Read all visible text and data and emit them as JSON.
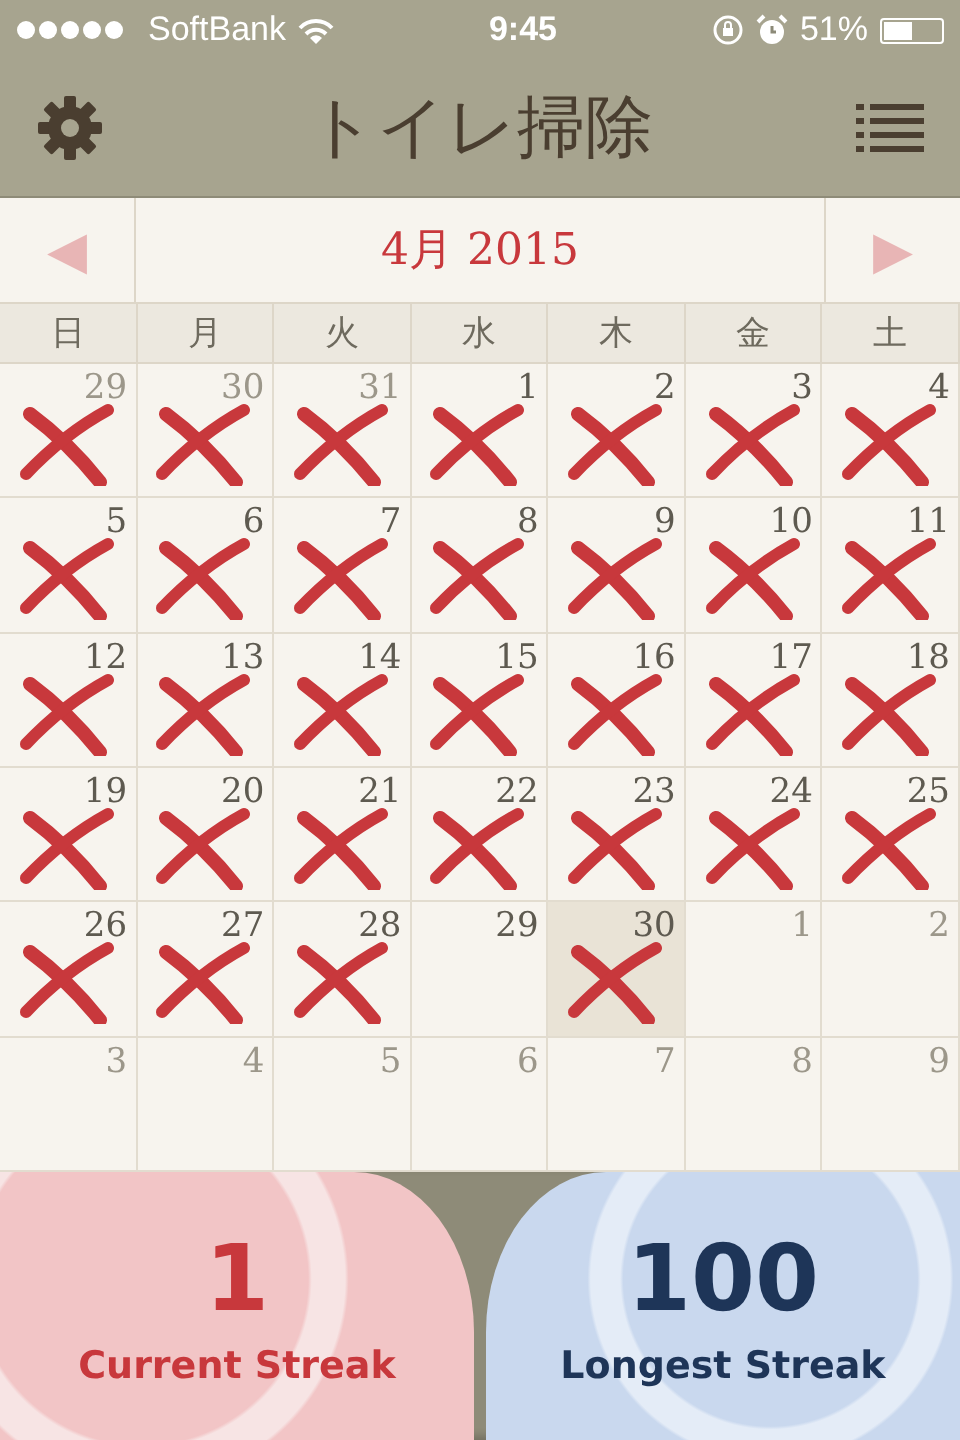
{
  "status_bar": {
    "carrier": "SoftBank",
    "time": "9:45",
    "battery": "51%"
  },
  "header": {
    "title": "トイレ掃除"
  },
  "month_nav": {
    "prev": "◀",
    "title": "4月 2015",
    "next": "▶"
  },
  "weekdays": [
    "日",
    "月",
    "火",
    "水",
    "木",
    "金",
    "土"
  ],
  "weeks": [
    [
      {
        "day": "29",
        "in_month": false,
        "marked": true,
        "selected": false
      },
      {
        "day": "30",
        "in_month": false,
        "marked": true,
        "selected": false
      },
      {
        "day": "31",
        "in_month": false,
        "marked": true,
        "selected": false
      },
      {
        "day": "1",
        "in_month": true,
        "marked": true,
        "selected": false
      },
      {
        "day": "2",
        "in_month": true,
        "marked": true,
        "selected": false
      },
      {
        "day": "3",
        "in_month": true,
        "marked": true,
        "selected": false
      },
      {
        "day": "4",
        "in_month": true,
        "marked": true,
        "selected": false
      }
    ],
    [
      {
        "day": "5",
        "in_month": true,
        "marked": true,
        "selected": false
      },
      {
        "day": "6",
        "in_month": true,
        "marked": true,
        "selected": false
      },
      {
        "day": "7",
        "in_month": true,
        "marked": true,
        "selected": false
      },
      {
        "day": "8",
        "in_month": true,
        "marked": true,
        "selected": false
      },
      {
        "day": "9",
        "in_month": true,
        "marked": true,
        "selected": false
      },
      {
        "day": "10",
        "in_month": true,
        "marked": true,
        "selected": false
      },
      {
        "day": "11",
        "in_month": true,
        "marked": true,
        "selected": false
      }
    ],
    [
      {
        "day": "12",
        "in_month": true,
        "marked": true,
        "selected": false
      },
      {
        "day": "13",
        "in_month": true,
        "marked": true,
        "selected": false
      },
      {
        "day": "14",
        "in_month": true,
        "marked": true,
        "selected": false
      },
      {
        "day": "15",
        "in_month": true,
        "marked": true,
        "selected": false
      },
      {
        "day": "16",
        "in_month": true,
        "marked": true,
        "selected": false
      },
      {
        "day": "17",
        "in_month": true,
        "marked": true,
        "selected": false
      },
      {
        "day": "18",
        "in_month": true,
        "marked": true,
        "selected": false
      }
    ],
    [
      {
        "day": "19",
        "in_month": true,
        "marked": true,
        "selected": false
      },
      {
        "day": "20",
        "in_month": true,
        "marked": true,
        "selected": false
      },
      {
        "day": "21",
        "in_month": true,
        "marked": true,
        "selected": false
      },
      {
        "day": "22",
        "in_month": true,
        "marked": true,
        "selected": false
      },
      {
        "day": "23",
        "in_month": true,
        "marked": true,
        "selected": false
      },
      {
        "day": "24",
        "in_month": true,
        "marked": true,
        "selected": false
      },
      {
        "day": "25",
        "in_month": true,
        "marked": true,
        "selected": false
      }
    ],
    [
      {
        "day": "26",
        "in_month": true,
        "marked": true,
        "selected": false
      },
      {
        "day": "27",
        "in_month": true,
        "marked": true,
        "selected": false
      },
      {
        "day": "28",
        "in_month": true,
        "marked": true,
        "selected": false
      },
      {
        "day": "29",
        "in_month": true,
        "marked": false,
        "selected": false
      },
      {
        "day": "30",
        "in_month": true,
        "marked": true,
        "selected": true
      },
      {
        "day": "1",
        "in_month": false,
        "marked": false,
        "selected": false
      },
      {
        "day": "2",
        "in_month": false,
        "marked": false,
        "selected": false
      }
    ],
    [
      {
        "day": "3",
        "in_month": false,
        "marked": false,
        "selected": false
      },
      {
        "day": "4",
        "in_month": false,
        "marked": false,
        "selected": false
      },
      {
        "day": "5",
        "in_month": false,
        "marked": false,
        "selected": false
      },
      {
        "day": "6",
        "in_month": false,
        "marked": false,
        "selected": false
      },
      {
        "day": "7",
        "in_month": false,
        "marked": false,
        "selected": false
      },
      {
        "day": "8",
        "in_month": false,
        "marked": false,
        "selected": false
      },
      {
        "day": "9",
        "in_month": false,
        "marked": false,
        "selected": false
      }
    ]
  ],
  "stats": [
    {
      "kind": "current",
      "value": "1",
      "label": "Current Streak"
    },
    {
      "kind": "longest",
      "value": "100",
      "label": "Longest Streak"
    }
  ]
}
